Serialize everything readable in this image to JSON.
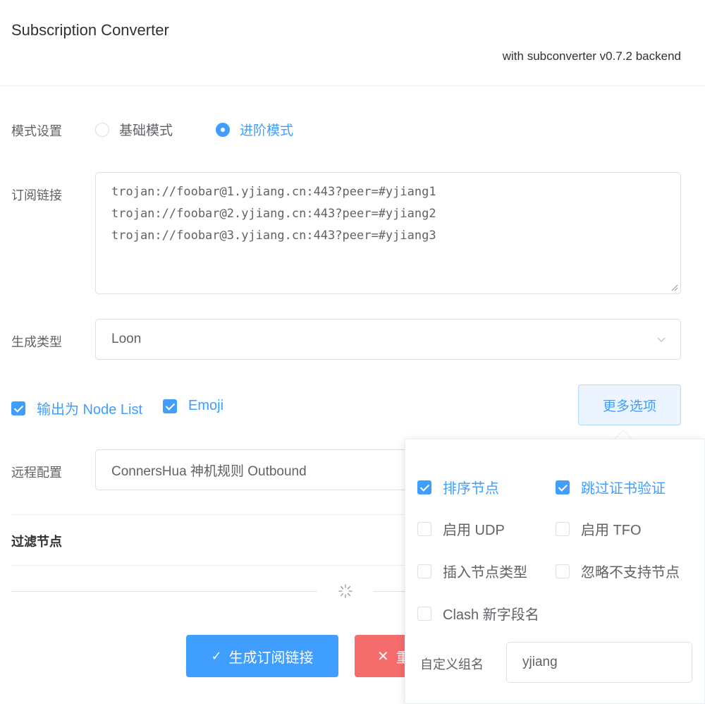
{
  "header": {
    "title": "Subscription Converter",
    "subtitle": "with subconverter v0.7.2 backend"
  },
  "mode": {
    "label": "模式设置",
    "options": [
      {
        "label": "基础模式",
        "checked": false
      },
      {
        "label": "进阶模式",
        "checked": true
      }
    ]
  },
  "subscription": {
    "label": "订阅链接",
    "lines": [
      "trojan://foobar@1.yjiang.cn:443?peer=#yjiang1",
      "trojan://foobar@2.yjiang.cn:443?peer=#yjiang2",
      "trojan://foobar@3.yjiang.cn:443?peer=#yjiang3"
    ]
  },
  "target": {
    "label": "生成类型",
    "value": "Loon"
  },
  "options": {
    "node_list_label": "输出为 Node List",
    "node_list_checked": true,
    "emoji_label": "Emoji",
    "emoji_checked": true,
    "more_button": "更多选项"
  },
  "remote_config": {
    "label": "远程配置",
    "value": "ConnersHua 神机规则 Outbound"
  },
  "filter": {
    "title": "过滤节点"
  },
  "actions": {
    "generate_label": "生成订阅链接",
    "generate_icon": "✓",
    "reset_icon": "✕",
    "reset_partial": "重"
  },
  "more_options": {
    "items": [
      {
        "label": "排序节点",
        "checked": true
      },
      {
        "label": "跳过证书验证",
        "checked": true
      },
      {
        "label": "启用 UDP",
        "checked": false
      },
      {
        "label": "启用 TFO",
        "checked": false
      },
      {
        "label": "插入节点类型",
        "checked": false
      },
      {
        "label": "忽略不支持节点",
        "checked": false
      },
      {
        "label": "Clash 新字段名",
        "checked": false
      }
    ],
    "group_name_label": "自定义组名",
    "group_name_value": "yjiang"
  },
  "colors": {
    "primary": "#409eff",
    "danger": "#f56c6c",
    "border": "#dcdfe6",
    "text": "#606266"
  }
}
